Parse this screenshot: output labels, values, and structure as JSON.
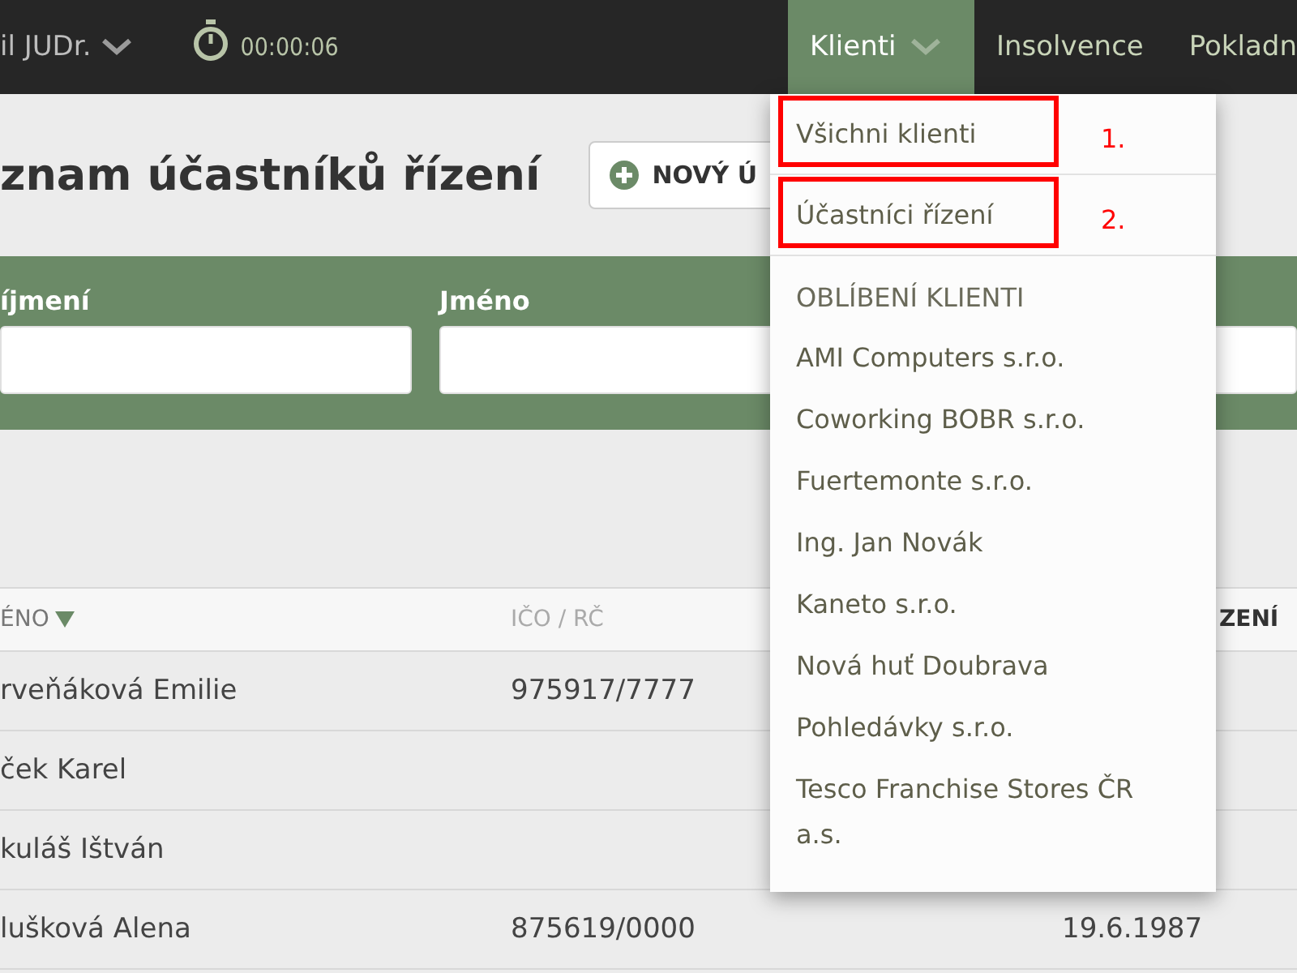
{
  "top_bar": {
    "user": "il JUDr.",
    "timer": "00:00:06",
    "nav": [
      {
        "label": "Klienti",
        "selected": true,
        "has_menu": true
      },
      {
        "label": "Insolvence",
        "selected": false,
        "has_menu": false
      },
      {
        "label": "Pokladn",
        "selected": false,
        "has_menu": false
      }
    ]
  },
  "page": {
    "title": "znam účastníků řízení",
    "new_button": "NOVÝ Ú"
  },
  "filters": [
    {
      "label": "íjmení"
    },
    {
      "label": "Jméno"
    }
  ],
  "table": {
    "columns": [
      {
        "label": "ÉNO",
        "sorted": true
      },
      {
        "label": "IČO / RČ",
        "sorted": false
      },
      {
        "label": "ZENÍ",
        "sorted": false
      }
    ],
    "rows": [
      {
        "name": "rveňáková Emilie",
        "id": "975917/7777"
      },
      {
        "name": "ček Karel"
      },
      {
        "name": "kuláš Ištván"
      },
      {
        "name": "lušková Alena",
        "id": "875619/0000",
        "date": "19.6.1987"
      }
    ]
  },
  "menu": {
    "items": [
      {
        "label": "Všichni klienti",
        "annotation": "1."
      },
      {
        "label": "Účastníci řízení",
        "annotation": "2."
      }
    ],
    "section": "OBLÍBENÍ KLIENTI",
    "favorites": [
      {
        "label": "AMI Computers s.r.o."
      },
      {
        "label": "Coworking BOBR s.r.o."
      },
      {
        "label": "Fuertemonte s.r.o."
      },
      {
        "label": "Ing. Jan Novák"
      },
      {
        "label": "Kaneto s.r.o."
      },
      {
        "label": "Nová huť Doubrava"
      },
      {
        "label": "Pohledávky s.r.o."
      },
      {
        "label": "Tesco Franchise Stores ČR a.s."
      }
    ]
  }
}
